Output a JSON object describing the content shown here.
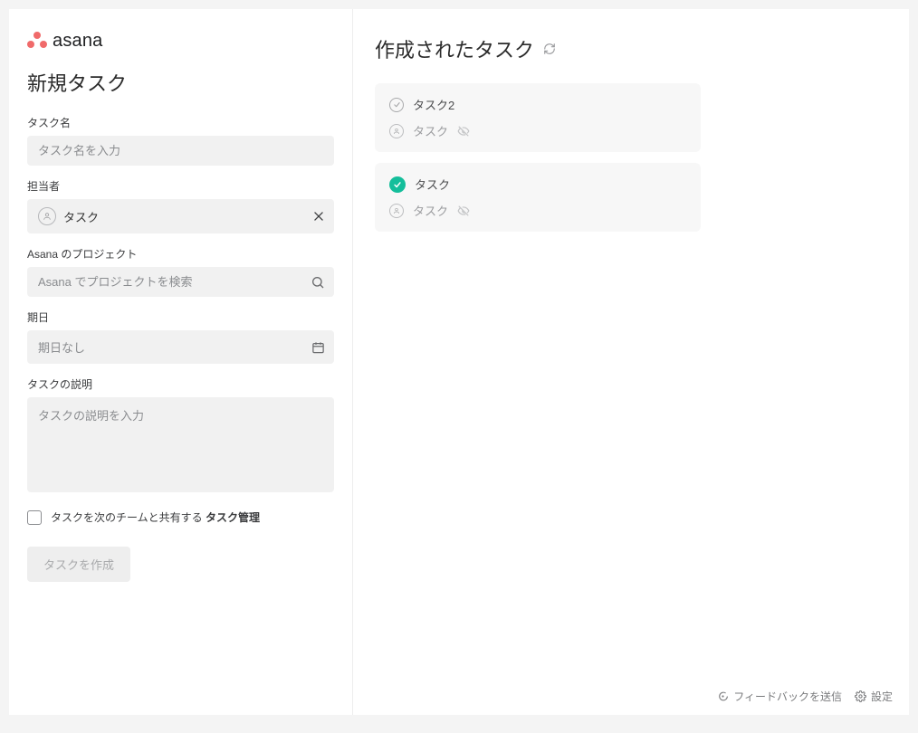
{
  "logo": {
    "text": "asana"
  },
  "left": {
    "title": "新規タスク",
    "task_name": {
      "label": "タスク名",
      "placeholder": "タスク名を入力",
      "value": ""
    },
    "assignee": {
      "label": "担当者",
      "value": "タスク"
    },
    "project": {
      "label": "Asana のプロジェクト",
      "placeholder": "Asana でプロジェクトを検索",
      "value": ""
    },
    "due_date": {
      "label": "期日",
      "placeholder": "期日なし",
      "value": ""
    },
    "description": {
      "label": "タスクの説明",
      "placeholder": "タスクの説明を入力",
      "value": ""
    },
    "share": {
      "prefix": "タスクを次のチームと共有する ",
      "team": "タスク管理"
    },
    "create_btn": "タスクを作成"
  },
  "right": {
    "title": "作成されたタスク",
    "tasks": [
      {
        "done": false,
        "title": "タスク2",
        "assignee": "タスク"
      },
      {
        "done": true,
        "title": "タスク",
        "assignee": "タスク"
      }
    ]
  },
  "footer": {
    "feedback": "フィードバックを送信",
    "settings": "設定"
  }
}
